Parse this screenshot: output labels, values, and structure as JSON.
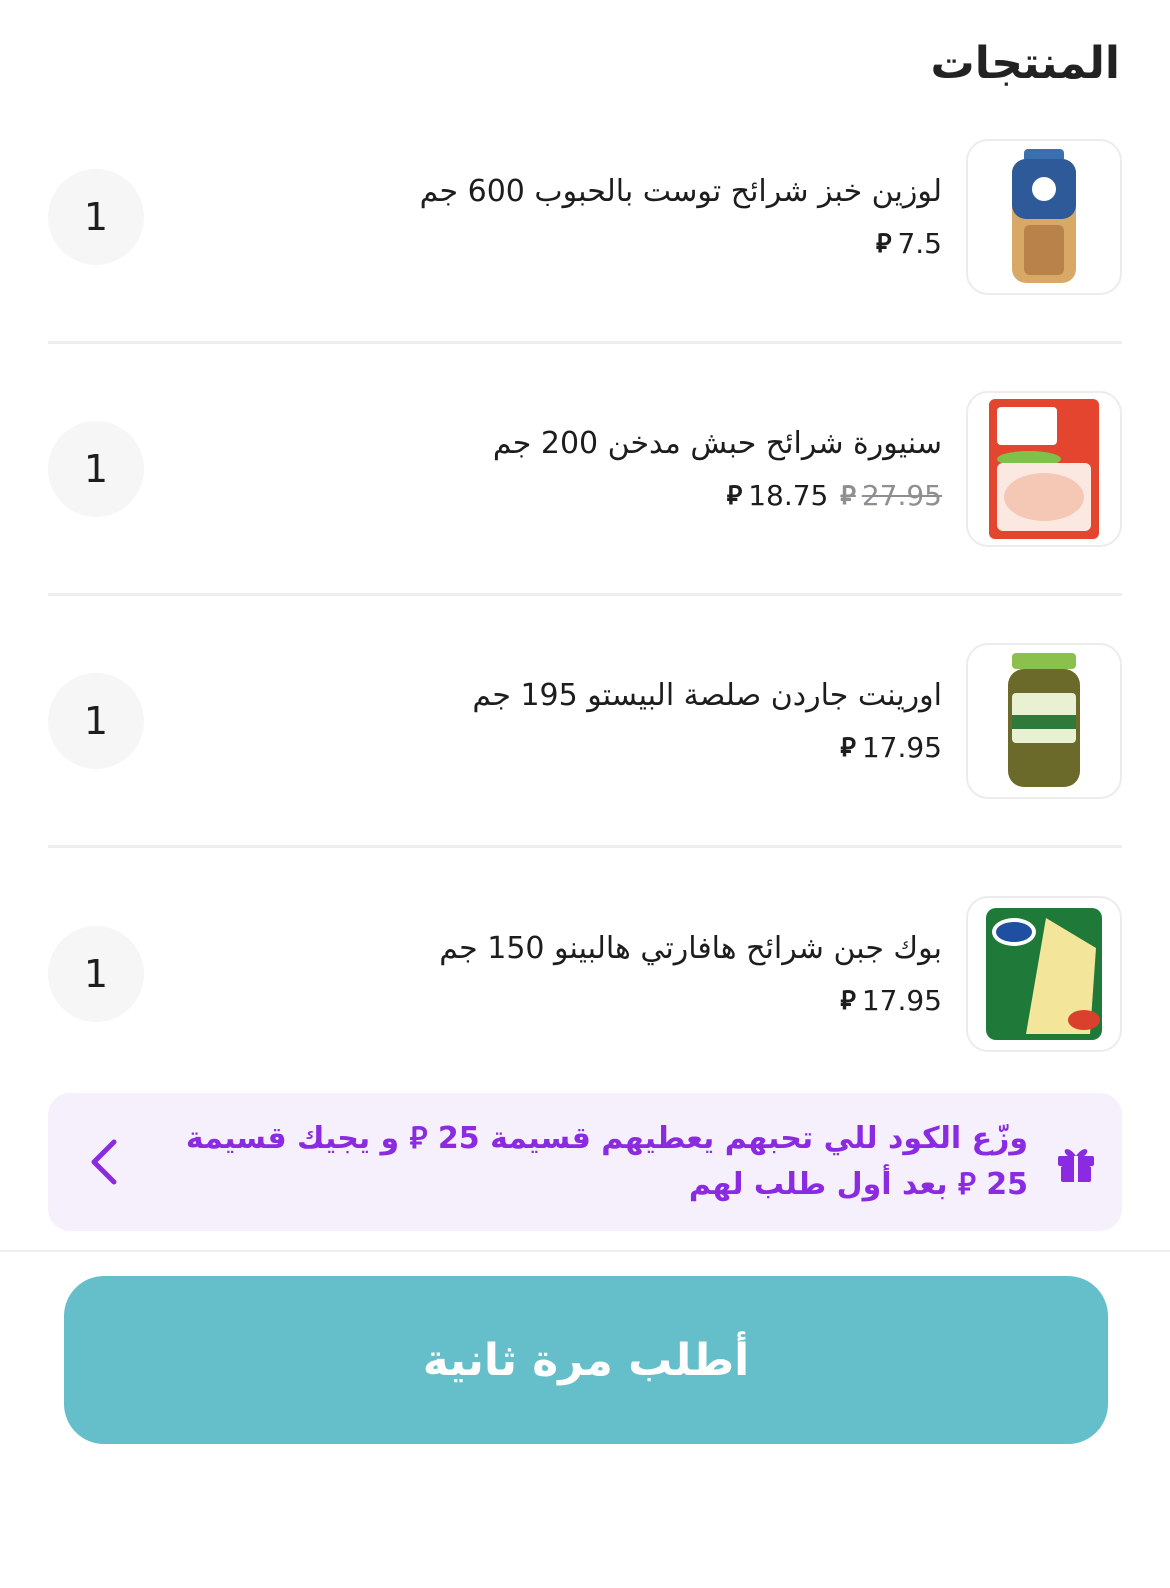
{
  "section_title": "المنتجات",
  "currency_symbol": "⃁",
  "products": [
    {
      "name": "لوزين خبز شرائح توست بالحبوب 600 جم",
      "price": "7.5",
      "old_price": null,
      "quantity": "1",
      "image_icon": "bread-package-icon"
    },
    {
      "name": "سنيورة شرائح حبش مدخن 200 جم",
      "price": "18.75",
      "old_price": "27.95",
      "quantity": "1",
      "image_icon": "turkey-slices-icon"
    },
    {
      "name": "اورينت جاردن صلصة البيستو 195 جم",
      "price": "17.95",
      "old_price": null,
      "quantity": "1",
      "image_icon": "pesto-jar-icon"
    },
    {
      "name": "بوك جبن شرائح هافارتي هالبينو 150 جم",
      "price": "17.95",
      "old_price": null,
      "quantity": "1",
      "image_icon": "cheese-package-icon"
    }
  ],
  "promo": {
    "text": "وزّع الكود للي تحبهم يعطيهم قسيمة 25 ⃁ و يجيك قسيمة 25 ⃁ بعد أول طلب لهم",
    "icon": "gift-icon",
    "chevron": "chevron-left-icon"
  },
  "reorder_button": "أطلب مرة ثانية",
  "colors": {
    "accent": "#65bfca",
    "promo_text": "#8a2be2",
    "promo_bg": "#f6effc"
  }
}
